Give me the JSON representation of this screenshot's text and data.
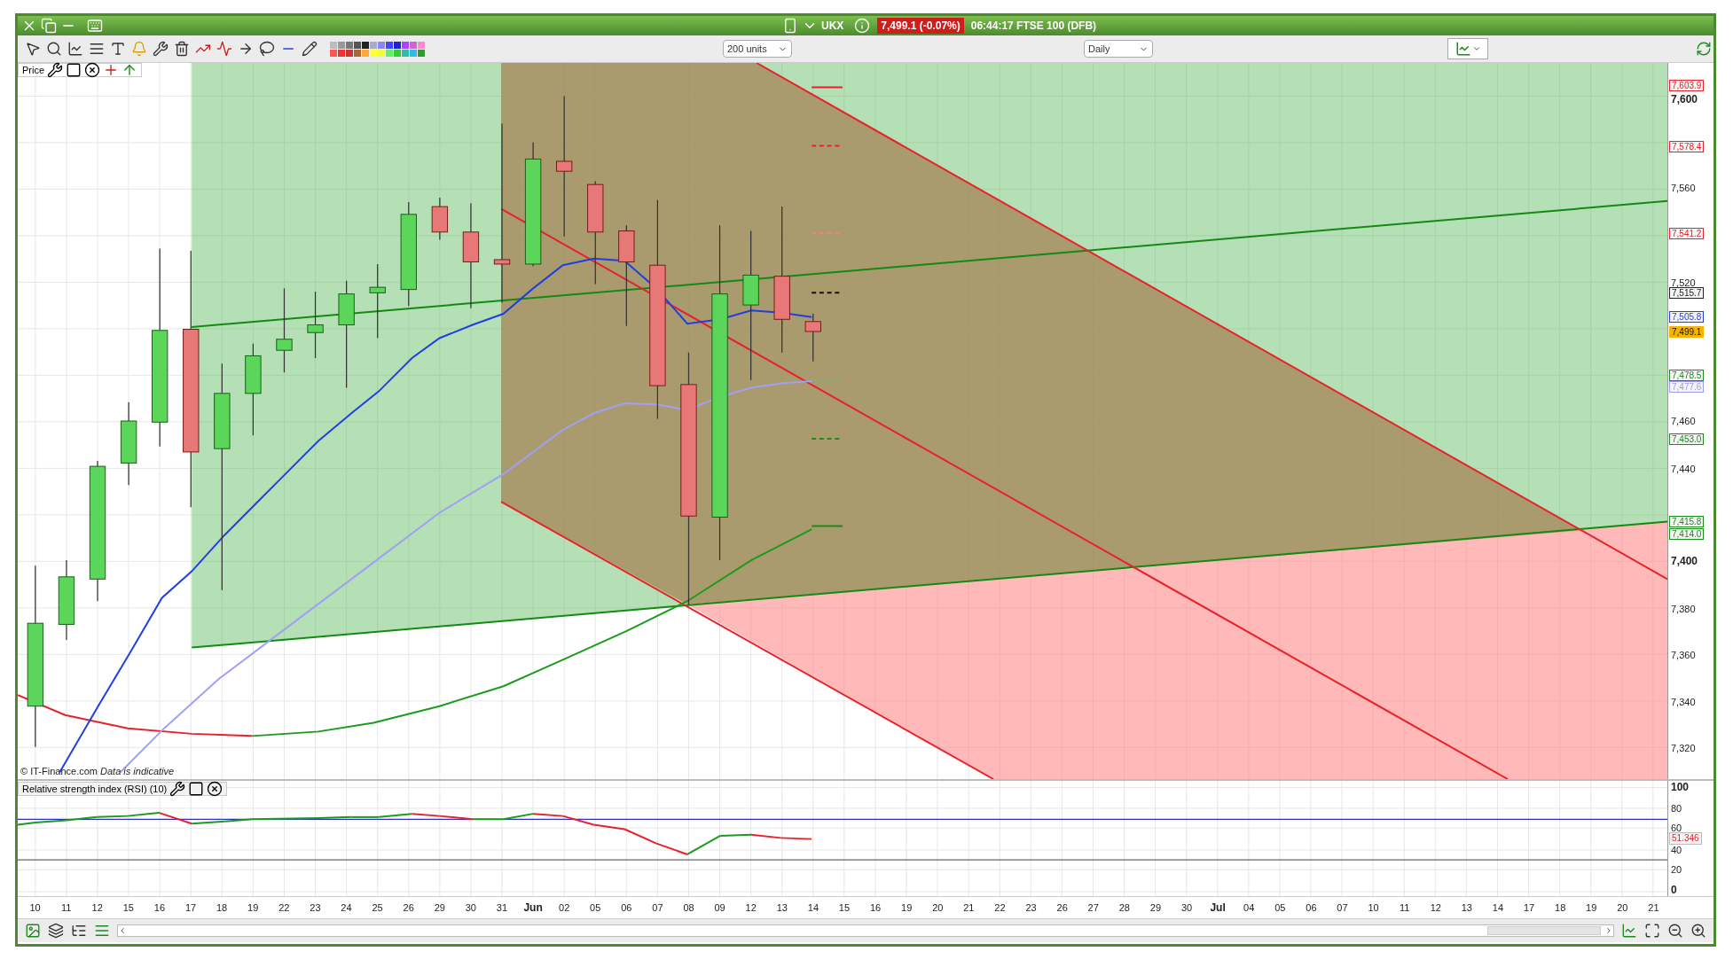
{
  "title_bar": {
    "symbol": "UKX",
    "price_badge": "7,499.1 (-0.07%)",
    "info": "06:44:17 FTSE 100 (DFB)"
  },
  "toolbar": {
    "units": "200 units",
    "period": "Daily"
  },
  "price_panel": {
    "label": "Price",
    "copyright": "© IT-Finance.com *Data is indicative*",
    "axis_ticks": [
      {
        "label": "7,600",
        "major": true
      },
      {
        "label": "7,560",
        "major": false
      },
      {
        "label": "7,520",
        "major": false
      },
      {
        "label": "7,460",
        "major": false
      },
      {
        "label": "7,440",
        "major": false
      },
      {
        "label": "7,400",
        "major": true
      },
      {
        "label": "7,380",
        "major": false
      },
      {
        "label": "7,360",
        "major": false
      },
      {
        "label": "7,340",
        "major": false
      },
      {
        "label": "7,320",
        "major": false
      }
    ],
    "price_tags": [
      {
        "label": "7,603.9",
        "kind": "level",
        "color": "#e8212a"
      },
      {
        "label": "7,578.4",
        "kind": "level",
        "color": "#e8212a"
      },
      {
        "label": "7,541.2",
        "kind": "level",
        "color": "#e8212a"
      },
      {
        "label": "7,515.7",
        "kind": "level",
        "color": "#222222"
      },
      {
        "label": "7,505.8",
        "kind": "level",
        "color": "#2340e8"
      },
      {
        "label": "7,499.1",
        "kind": "current",
        "color": "#f5b400"
      },
      {
        "label": "7,478.5",
        "kind": "level",
        "color": "#1c8a1c"
      },
      {
        "label": "7,477.6",
        "kind": "level",
        "color": "#9c9cf0"
      },
      {
        "label": "7,453.0",
        "kind": "level",
        "color": "#1c8a1c"
      },
      {
        "label": "7,415.8",
        "kind": "level",
        "color": "#1c8a1c"
      },
      {
        "label": "7,414.0",
        "kind": "level",
        "color": "#1c8a1c"
      }
    ]
  },
  "rsi_panel": {
    "label": "Relative strength index (RSI) (10)",
    "axis_ticks": [
      {
        "label": "100",
        "major": true
      },
      {
        "label": "80",
        "major": false
      },
      {
        "label": "60",
        "major": false
      },
      {
        "label": "40",
        "major": false
      },
      {
        "label": "20",
        "major": false
      },
      {
        "label": "0",
        "major": true
      }
    ],
    "value_tag": {
      "label": "51.346",
      "color": "#e8212a"
    }
  },
  "date_axis": [
    {
      "label": "10",
      "kind": "day"
    },
    {
      "label": "11",
      "kind": "day"
    },
    {
      "label": "12",
      "kind": "day"
    },
    {
      "label": "15",
      "kind": "day"
    },
    {
      "label": "16",
      "kind": "day"
    },
    {
      "label": "17",
      "kind": "day"
    },
    {
      "label": "18",
      "kind": "day"
    },
    {
      "label": "19",
      "kind": "day"
    },
    {
      "label": "22",
      "kind": "day"
    },
    {
      "label": "23",
      "kind": "day"
    },
    {
      "label": "24",
      "kind": "day"
    },
    {
      "label": "25",
      "kind": "day"
    },
    {
      "label": "26",
      "kind": "day"
    },
    {
      "label": "29",
      "kind": "day"
    },
    {
      "label": "30",
      "kind": "day"
    },
    {
      "label": "31",
      "kind": "day"
    },
    {
      "label": "Jun",
      "kind": "month"
    },
    {
      "label": "02",
      "kind": "day"
    },
    {
      "label": "05",
      "kind": "day"
    },
    {
      "label": "06",
      "kind": "day"
    },
    {
      "label": "07",
      "kind": "day"
    },
    {
      "label": "08",
      "kind": "day"
    },
    {
      "label": "09",
      "kind": "day"
    },
    {
      "label": "12",
      "kind": "day"
    },
    {
      "label": "13",
      "kind": "day"
    },
    {
      "label": "14",
      "kind": "day"
    },
    {
      "label": "15",
      "kind": "day"
    },
    {
      "label": "16",
      "kind": "day"
    },
    {
      "label": "19",
      "kind": "day"
    },
    {
      "label": "20",
      "kind": "day"
    },
    {
      "label": "21",
      "kind": "day"
    },
    {
      "label": "22",
      "kind": "day"
    },
    {
      "label": "23",
      "kind": "day"
    },
    {
      "label": "26",
      "kind": "day"
    },
    {
      "label": "27",
      "kind": "day"
    },
    {
      "label": "28",
      "kind": "day"
    },
    {
      "label": "29",
      "kind": "day"
    },
    {
      "label": "30",
      "kind": "day"
    },
    {
      "label": "Jul",
      "kind": "month"
    },
    {
      "label": "04",
      "kind": "day"
    },
    {
      "label": "05",
      "kind": "day"
    },
    {
      "label": "06",
      "kind": "day"
    },
    {
      "label": "07",
      "kind": "day"
    },
    {
      "label": "10",
      "kind": "day"
    },
    {
      "label": "11",
      "kind": "day"
    },
    {
      "label": "12",
      "kind": "day"
    },
    {
      "label": "13",
      "kind": "day"
    },
    {
      "label": "14",
      "kind": "day"
    },
    {
      "label": "17",
      "kind": "day"
    },
    {
      "label": "18",
      "kind": "day"
    },
    {
      "label": "19",
      "kind": "day"
    },
    {
      "label": "20",
      "kind": "day"
    },
    {
      "label": "21",
      "kind": "day"
    }
  ]
}
